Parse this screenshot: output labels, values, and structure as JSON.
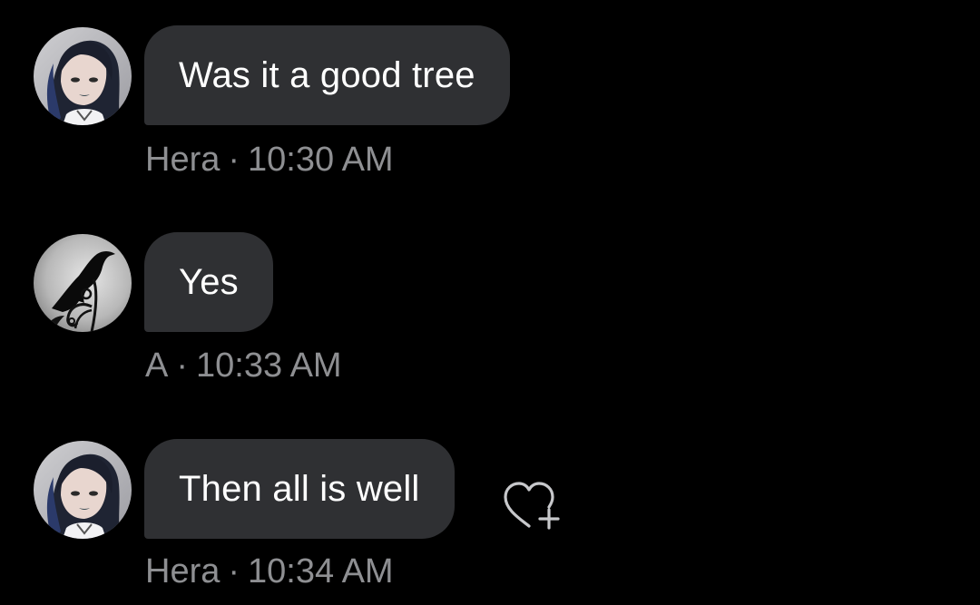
{
  "messages": [
    {
      "sender": "Hera",
      "text": "Was it a good tree",
      "time": "10:30 AM",
      "avatar": "hera-avatar"
    },
    {
      "sender": "A",
      "text": "Yes",
      "time": "10:33 AM",
      "avatar": "crow-avatar"
    },
    {
      "sender": "Hera",
      "text": "Then all is well",
      "time": "10:34 AM",
      "avatar": "hera-avatar",
      "reaction_button_icon": "heart-plus-icon"
    }
  ],
  "meta_separator": "·",
  "colors": {
    "background": "#000000",
    "bubble": "#2f3033",
    "message_text": "#ffffff",
    "meta_text": "#8e8f92"
  }
}
